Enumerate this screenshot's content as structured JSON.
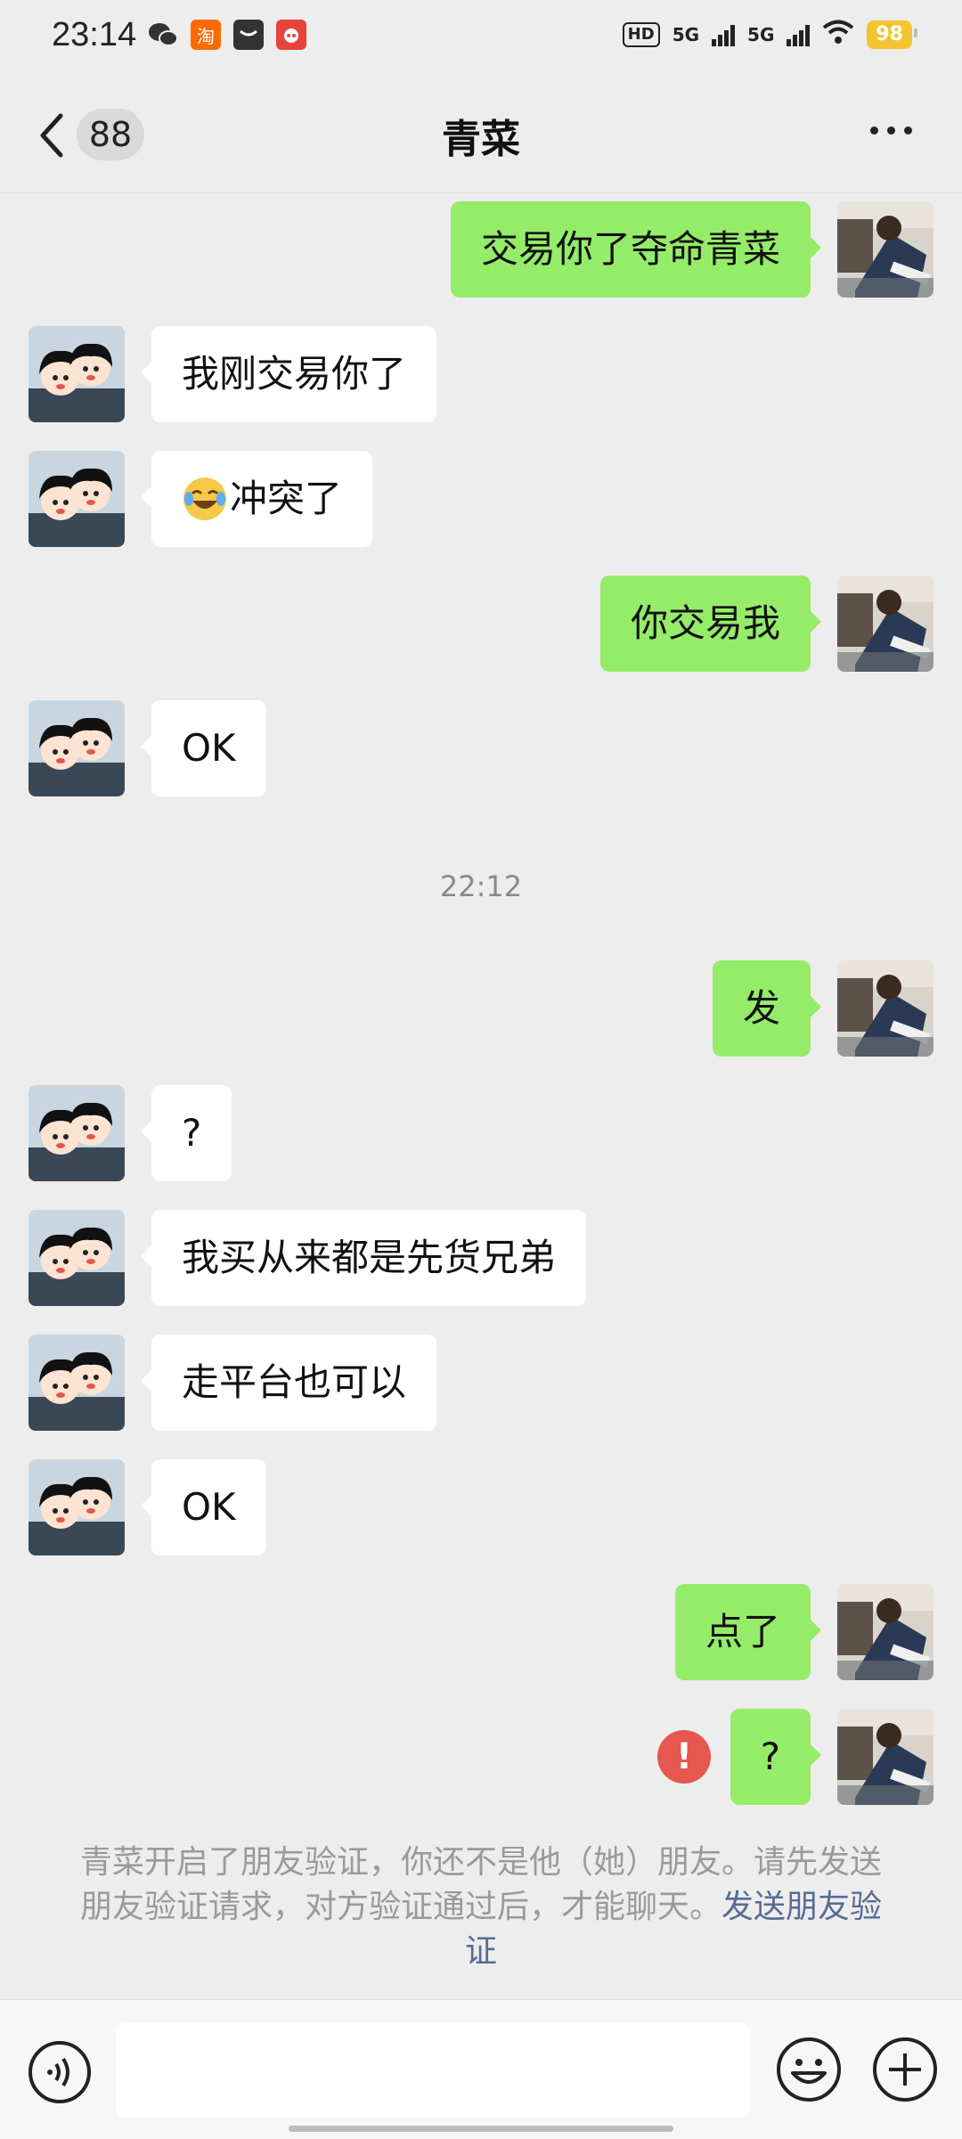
{
  "status_bar": {
    "time": "23:14",
    "notif_taobao": "淘",
    "hd_label": "HD",
    "net1": "5G",
    "net2": "5G",
    "battery": "98"
  },
  "header": {
    "unread_count": "88",
    "title": "青菜"
  },
  "messages": [
    {
      "side": "out",
      "text": "交易你了夺命青菜"
    },
    {
      "side": "in",
      "text": "我刚交易你了"
    },
    {
      "side": "in",
      "text": "冲突了",
      "emoji": "face-with-tears-of-joy"
    },
    {
      "side": "out",
      "text": "你交易我"
    },
    {
      "side": "in",
      "text": "OK"
    },
    {
      "side": "out",
      "text": "发"
    },
    {
      "side": "in",
      "text": "?"
    },
    {
      "side": "in",
      "text": "我买从来都是先货兄弟"
    },
    {
      "side": "in",
      "text": "走平台也可以"
    },
    {
      "side": "in",
      "text": "OK"
    },
    {
      "side": "out",
      "text": "点了"
    },
    {
      "side": "out",
      "text": "?",
      "failed": true
    }
  ],
  "time_separator": "22:12",
  "notice": {
    "text": "青菜开启了朋友验证，你还不是他（她）朋友。请先发送朋友验证请求，对方验证通过后，才能聊天。",
    "link": "发送朋友验证"
  },
  "input_bar": {
    "placeholder": ""
  },
  "colors": {
    "background": "#ededed",
    "outgoing_bubble": "#95ec69",
    "incoming_bubble": "#ffffff",
    "link": "#576b95",
    "error": "#e5574f"
  }
}
